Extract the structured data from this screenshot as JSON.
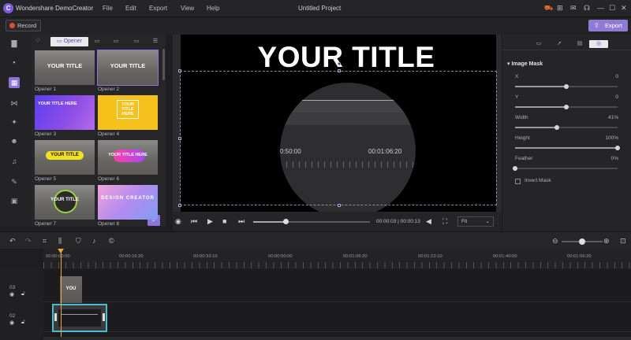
{
  "app": {
    "name": "Wondershare DemoCreator",
    "logo_letter": "C",
    "project_title": "Untitled Project",
    "menu": [
      "File",
      "Edit",
      "Export",
      "View",
      "Help"
    ],
    "title_icons": [
      "cart-icon",
      "gift-icon",
      "mail-icon",
      "headset-icon",
      "minimize-icon",
      "maximize-icon",
      "close-icon"
    ]
  },
  "toolbar": {
    "record_label": "Record",
    "export_label": "Export"
  },
  "sidebar": {
    "items": [
      {
        "icon": "folder-icon",
        "glyph": "▇"
      },
      {
        "icon": "caption-icon",
        "glyph": "▪"
      },
      {
        "icon": "templates-icon",
        "glyph": "▦",
        "active": true
      },
      {
        "icon": "transition-icon",
        "glyph": "⋈"
      },
      {
        "icon": "effects-icon",
        "glyph": "✦"
      },
      {
        "icon": "sticker-icon",
        "glyph": "☻",
        "badge": true
      },
      {
        "icon": "audio-icon",
        "glyph": "♫"
      },
      {
        "icon": "pin-icon",
        "glyph": "✎"
      },
      {
        "icon": "store-icon",
        "glyph": "▣",
        "badge": true
      }
    ]
  },
  "library": {
    "tabs": [
      {
        "label": "",
        "icon": "heart-icon"
      },
      {
        "label": "Opener",
        "icon": "opener-icon",
        "active": true
      },
      {
        "label": "",
        "icon": "lowerthird-icon"
      },
      {
        "label": "",
        "icon": "subtitle-icon"
      },
      {
        "label": "",
        "icon": "endcredit-icon"
      },
      {
        "label": "",
        "icon": "list-icon"
      }
    ],
    "items": [
      {
        "label": "Opener 1",
        "text": "YOUR TITLE",
        "style": "gray"
      },
      {
        "label": "Opener 2",
        "text": "YOUR TITLE",
        "style": "gray",
        "selected": true
      },
      {
        "label": "Opener 3",
        "text": "YOUR TITLE HERE",
        "style": "purple"
      },
      {
        "label": "Opener 4",
        "text": "YOUR TITLE HERE",
        "style": "yellow"
      },
      {
        "label": "Opener 5",
        "text": "YOUR TITLE",
        "style": "gray-yellowbar"
      },
      {
        "label": "Opener 6",
        "text": "YOUR TITLE HERE",
        "style": "gray-blob"
      },
      {
        "label": "Opener 7",
        "text": "YOUR TITLE",
        "style": "gray-green"
      },
      {
        "label": "Opener 8",
        "text": "DESIGN CREATOR",
        "style": "pink"
      }
    ]
  },
  "preview": {
    "title_text": "YOUR TITLE",
    "inner_time_left": "0:50:00",
    "inner_time_right": "00:01:06:20"
  },
  "playback": {
    "time": "00:00:03 | 00:00:13",
    "fit": "Fit",
    "progress": 0.28
  },
  "properties": {
    "tabs": [
      "video-tab-icon",
      "cursor-tab-icon",
      "caption-tab-icon",
      "mask-tab-icon"
    ],
    "section_title": "Image Mask",
    "params": [
      {
        "label": "X",
        "value": "0",
        "pos": 0.5
      },
      {
        "label": "Y",
        "value": "0",
        "pos": 0.5
      },
      {
        "label": "Width",
        "value": "41%",
        "pos": 0.41
      },
      {
        "label": "Height",
        "value": "100%",
        "pos": 1.0
      },
      {
        "label": "Feather",
        "value": "0%",
        "pos": 0.0
      }
    ],
    "invert_label": "Invert Mask"
  },
  "timeline": {
    "tools": [
      "undo-icon",
      "redo-icon",
      "crop-icon",
      "split-icon",
      "marker-icon",
      "mic-icon",
      "copyright-icon"
    ],
    "ruler": [
      "00:00:00:00",
      "00:00:16:20",
      "00:00:33:10",
      "00:00:50:00",
      "00:01:06:20",
      "00:01:23:10",
      "00:01:40:00",
      "00:01:56:20"
    ],
    "tracks": [
      {
        "num": "03"
      },
      {
        "num": "02"
      }
    ],
    "clip1_text": "YOU",
    "zoom": 0.5
  }
}
